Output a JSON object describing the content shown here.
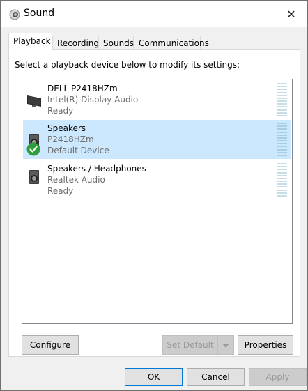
{
  "window": {
    "title": "Sound",
    "close_glyph": "✕"
  },
  "tabs": [
    {
      "label": "Playback",
      "active": true
    },
    {
      "label": "Recording",
      "active": false
    },
    {
      "label": "Sounds",
      "active": false
    },
    {
      "label": "Communications",
      "active": false
    }
  ],
  "instruction": "Select a playback device below to modify its settings:",
  "devices": [
    {
      "name": "DELL P2418HZm",
      "driver": "Intel(R) Display Audio",
      "status": "Ready",
      "icon": "monitor-icon",
      "selected": false
    },
    {
      "name": "Speakers",
      "driver": "P2418HZm",
      "status": "Default Device",
      "icon": "speaker-icon",
      "selected": true,
      "default": true
    },
    {
      "name": "Speakers / Headphones",
      "driver": "Realtek Audio",
      "status": "Ready",
      "icon": "speaker-icon",
      "selected": false
    }
  ],
  "buttons": {
    "configure": "Configure",
    "set_default": "Set Default",
    "properties": "Properties",
    "ok": "OK",
    "cancel": "Cancel",
    "apply": "Apply"
  },
  "colors": {
    "selected_row": "#cce8ff",
    "default_check": "#2e9e3b",
    "accent_border": "#0078d7"
  }
}
